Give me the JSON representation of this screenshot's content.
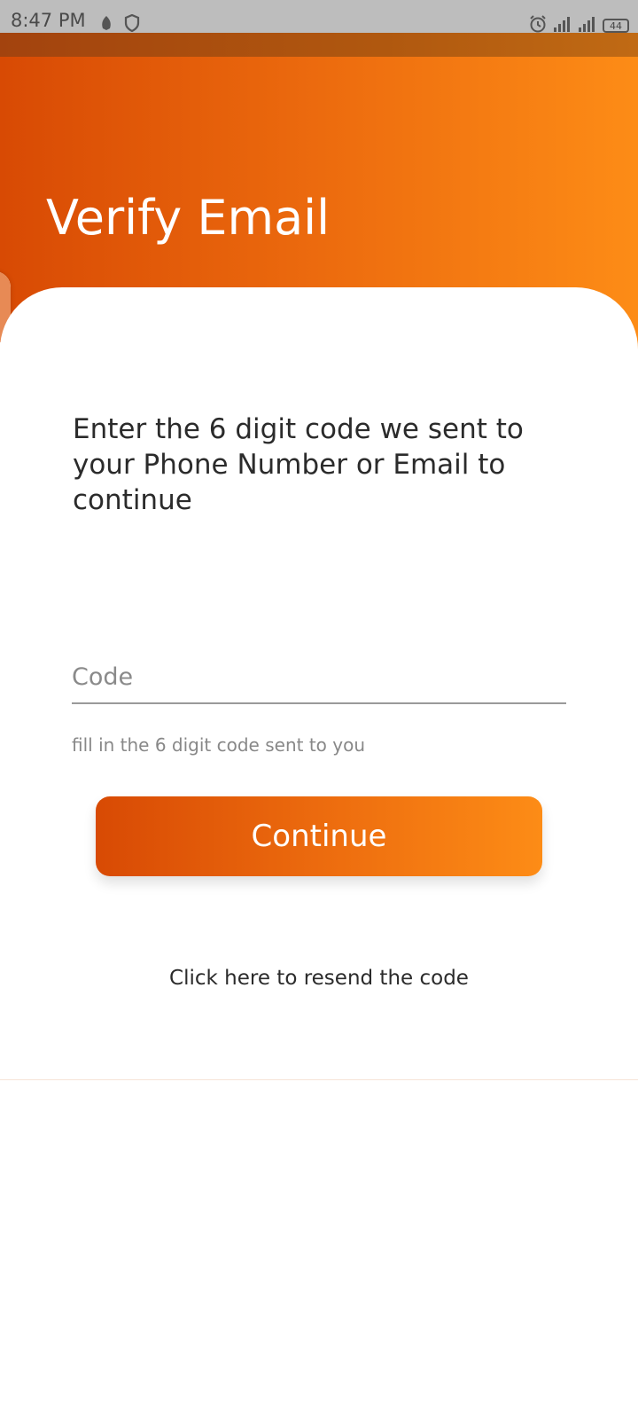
{
  "status_bar": {
    "time": "8:47 PM",
    "left_icons": [
      "leaf-icon",
      "shield-icon"
    ],
    "right_icons": [
      "alarm-icon",
      "signal-icon",
      "signal-icon"
    ],
    "battery": "44"
  },
  "header": {
    "title": "Verify Email"
  },
  "card": {
    "instructions": "Enter the 6 digit code we sent to your Phone Number or Email to continue",
    "code_input": {
      "placeholder": "Code",
      "value": ""
    },
    "helper_text": "fill in the 6 digit code sent to you",
    "continue_label": "Continue",
    "resend_label": "Click here to resend the code"
  },
  "colors": {
    "gradient_start": "#d84a04",
    "gradient_end": "#fd8c16",
    "text_dark": "#2b2b2b",
    "text_muted": "#888888"
  }
}
